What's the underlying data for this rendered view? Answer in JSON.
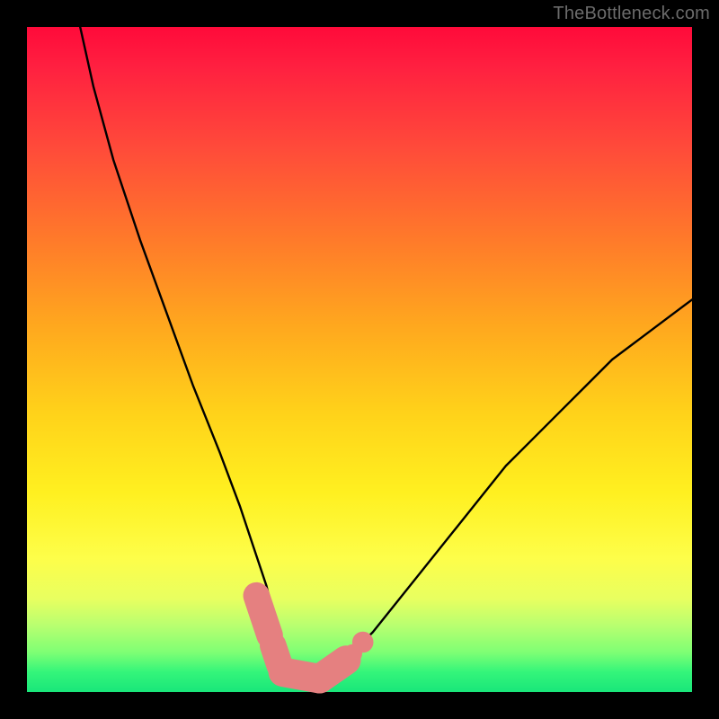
{
  "watermark": "TheBottleneck.com",
  "colors": {
    "frame": "#000000",
    "gradient_top": "#ff0a3a",
    "gradient_bottom": "#19e67a",
    "curve_stroke": "#000000",
    "marker_fill": "#e58080",
    "marker_stroke": "#d86e6e"
  },
  "chart_data": {
    "type": "line",
    "title": "",
    "xlabel": "",
    "ylabel": "",
    "xlim": [
      0,
      100
    ],
    "ylim": [
      0,
      100
    ],
    "series": [
      {
        "name": "bottleneck-curve",
        "x": [
          8,
          10,
          13,
          17,
          21,
          25,
          29,
          32,
          34,
          36,
          37,
          38,
          39,
          40,
          42,
          44,
          46,
          48,
          52,
          56,
          60,
          64,
          68,
          72,
          76,
          80,
          84,
          88,
          92,
          96,
          100
        ],
        "y": [
          100,
          91,
          80,
          68,
          57,
          46,
          36,
          28,
          22,
          16,
          12,
          8,
          5,
          3,
          2,
          2,
          3,
          5,
          9,
          14,
          19,
          24,
          29,
          34,
          38,
          42,
          46,
          50,
          53,
          56,
          59
        ]
      }
    ],
    "markers": [
      {
        "kind": "capsule",
        "x1": 34.5,
        "y1": 14.5,
        "x2": 36.5,
        "y2": 8.5,
        "r": 2.0
      },
      {
        "kind": "capsule",
        "x1": 37.0,
        "y1": 7.0,
        "x2": 38.0,
        "y2": 4.0,
        "r": 2.0
      },
      {
        "kind": "capsule",
        "x1": 38.5,
        "y1": 3.0,
        "x2": 44.0,
        "y2": 2.0,
        "r": 2.2
      },
      {
        "kind": "capsule",
        "x1": 44.0,
        "y1": 2.0,
        "x2": 48.0,
        "y2": 4.8,
        "r": 2.2
      },
      {
        "kind": "dot",
        "x": 50.5,
        "y": 7.5,
        "r": 1.6
      },
      {
        "kind": "dot",
        "x": 49.0,
        "y": 5.8,
        "r": 1.4
      }
    ]
  }
}
